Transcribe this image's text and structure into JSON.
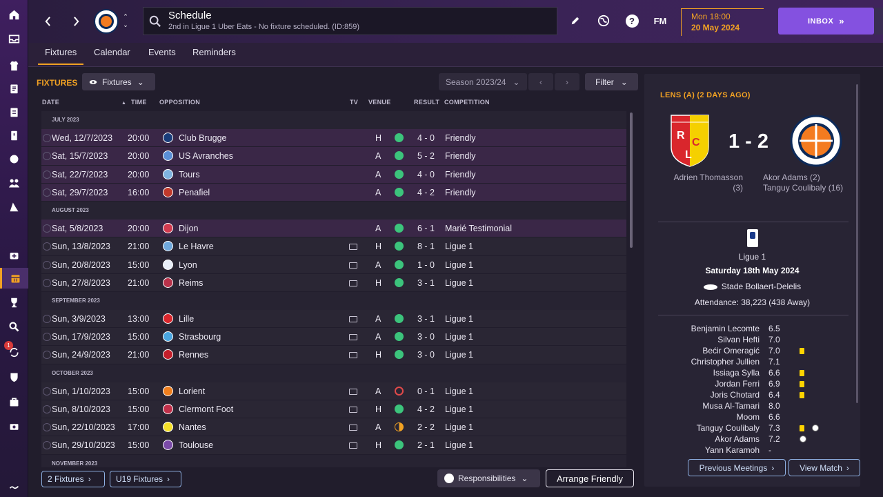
{
  "sidebar": {
    "badge_count": "1",
    "items": [
      "home-icon",
      "inbox-icon",
      "squad-icon",
      "tactics-icon",
      "data-icon",
      "staff-icon",
      "training-icon",
      "medical-icon",
      "schedule-icon",
      "competitions-icon",
      "scouting-icon",
      "transfers-icon",
      "club-vision-icon",
      "finances-icon",
      "dev-centre-icon",
      "report-icon",
      "settings-icon"
    ]
  },
  "header": {
    "title": "Schedule",
    "subtitle": "2nd in Ligue 1 Uber Eats - No fixture scheduled. (ID:859)",
    "fm_label": "FM",
    "date_line1": "Mon 18:00",
    "date_line2": "20 May 2024",
    "inbox_label": "INBOX"
  },
  "tabs": [
    "Fixtures",
    "Calendar",
    "Events",
    "Reminders"
  ],
  "fixtures": {
    "heading": "FIXTURES",
    "view_dropdown": "Fixtures",
    "season": "Season 2023/24",
    "filter": "Filter",
    "columns": {
      "date": "DATE",
      "time": "TIME",
      "opposition": "OPPOSITION",
      "tv": "TV",
      "venue": "VENUE",
      "result": "RESULT",
      "competition": "COMPETITION"
    },
    "groups": [
      {
        "month": "JULY 2023",
        "rows": [
          {
            "date": "Wed, 12/7/2023",
            "time": "20:00",
            "opp": "Club Brugge",
            "tv": false,
            "venue": "H",
            "outcome": "w",
            "result": "4 - 0",
            "comp": "Friendly",
            "hl": true,
            "color": "#1a3d7a"
          },
          {
            "date": "Sat, 15/7/2023",
            "time": "20:00",
            "opp": "US Avranches",
            "tv": false,
            "venue": "A",
            "outcome": "w",
            "result": "5 - 2",
            "comp": "Friendly",
            "hl": true,
            "color": "#5a8fd6"
          },
          {
            "date": "Sat, 22/7/2023",
            "time": "20:00",
            "opp": "Tours",
            "tv": false,
            "venue": "A",
            "outcome": "w",
            "result": "4 - 0",
            "comp": "Friendly",
            "hl": true,
            "color": "#7fb3e0"
          },
          {
            "date": "Sat, 29/7/2023",
            "time": "16:00",
            "opp": "Penafiel",
            "tv": false,
            "venue": "A",
            "outcome": "w",
            "result": "4 - 2",
            "comp": "Friendly",
            "hl": true,
            "color": "#c0392b"
          }
        ]
      },
      {
        "month": "AUGUST 2023",
        "rows": [
          {
            "date": "Sat, 5/8/2023",
            "time": "20:00",
            "opp": "Dijon",
            "tv": false,
            "venue": "A",
            "outcome": "w",
            "result": "6 - 1",
            "comp": "Marié Testimonial",
            "hl": true,
            "color": "#d23a4f"
          },
          {
            "date": "Sun, 13/8/2023",
            "time": "21:00",
            "opp": "Le Havre",
            "tv": true,
            "venue": "H",
            "outcome": "w",
            "result": "8 - 1",
            "comp": "Ligue 1",
            "hl": false,
            "color": "#6fa8dc"
          },
          {
            "date": "Sun, 20/8/2023",
            "time": "15:00",
            "opp": "Lyon",
            "tv": true,
            "venue": "A",
            "outcome": "w",
            "result": "1 - 0",
            "comp": "Ligue 1",
            "hl": false,
            "color": "#e8eef8"
          },
          {
            "date": "Sun, 27/8/2023",
            "time": "21:00",
            "opp": "Reims",
            "tv": true,
            "venue": "H",
            "outcome": "w",
            "result": "3 - 1",
            "comp": "Ligue 1",
            "hl": false,
            "color": "#b8324a"
          }
        ]
      },
      {
        "month": "SEPTEMBER 2023",
        "rows": [
          {
            "date": "Sun, 3/9/2023",
            "time": "13:00",
            "opp": "Lille",
            "tv": true,
            "venue": "A",
            "outcome": "w",
            "result": "3 - 1",
            "comp": "Ligue 1",
            "hl": false,
            "color": "#d9262c"
          },
          {
            "date": "Sun, 17/9/2023",
            "time": "15:00",
            "opp": "Strasbourg",
            "tv": true,
            "venue": "A",
            "outcome": "w",
            "result": "3 - 0",
            "comp": "Ligue 1",
            "hl": false,
            "color": "#4aa6e0"
          },
          {
            "date": "Sun, 24/9/2023",
            "time": "21:00",
            "opp": "Rennes",
            "tv": true,
            "venue": "H",
            "outcome": "w",
            "result": "3 - 0",
            "comp": "Ligue 1",
            "hl": false,
            "color": "#c41e2a"
          }
        ]
      },
      {
        "month": "OCTOBER 2023",
        "rows": [
          {
            "date": "Sun, 1/10/2023",
            "time": "15:00",
            "opp": "Lorient",
            "tv": true,
            "venue": "A",
            "outcome": "l",
            "result": "0 - 1",
            "comp": "Ligue 1",
            "hl": false,
            "color": "#f07f1e"
          },
          {
            "date": "Sun, 8/10/2023",
            "time": "15:00",
            "opp": "Clermont Foot",
            "tv": true,
            "venue": "H",
            "outcome": "w",
            "result": "4 - 2",
            "comp": "Ligue 1",
            "hl": false,
            "color": "#c0304a"
          },
          {
            "date": "Sun, 22/10/2023",
            "time": "17:00",
            "opp": "Nantes",
            "tv": true,
            "venue": "A",
            "outcome": "d",
            "result": "2 - 2",
            "comp": "Ligue 1",
            "hl": false,
            "color": "#f5e02a"
          },
          {
            "date": "Sun, 29/10/2023",
            "time": "15:00",
            "opp": "Toulouse",
            "tv": true,
            "venue": "H",
            "outcome": "w",
            "result": "2 - 1",
            "comp": "Ligue 1",
            "hl": false,
            "color": "#7b4ba8"
          }
        ]
      },
      {
        "month": "NOVEMBER 2023",
        "rows": []
      }
    ],
    "footer": {
      "fixtures_btn": "2 Fixtures",
      "u19_btn": "U19 Fixtures",
      "responsibilities": "Responsibilities",
      "arrange": "Arrange Friendly"
    }
  },
  "match": {
    "title": "LENS (A) (2 DAYS AGO)",
    "score": "1 - 2",
    "home_scorer": "Adrien Thomasson (3)",
    "away_scorers": [
      "Akor Adams (2)",
      "Tanguy Coulibaly (16)"
    ],
    "competition": "Ligue 1",
    "date": "Saturday 18th May 2024",
    "stadium": "Stade Bollaert-Delelis",
    "attendance": "Attendance: 38,223 (438 Away)",
    "ratings": [
      {
        "name": "Benjamin Lecomte",
        "rating": "6.5",
        "yellow": false,
        "goal": false
      },
      {
        "name": "Silvan Hefti",
        "rating": "7.0",
        "yellow": false,
        "goal": false
      },
      {
        "name": "Bećir Omeragić",
        "rating": "7.0",
        "yellow": true,
        "goal": false
      },
      {
        "name": "Christopher Jullien",
        "rating": "7.1",
        "yellow": false,
        "goal": false
      },
      {
        "name": "Issiaga Sylla",
        "rating": "6.6",
        "yellow": true,
        "goal": false
      },
      {
        "name": "Jordan Ferri",
        "rating": "6.9",
        "yellow": true,
        "goal": false
      },
      {
        "name": "Joris Chotard",
        "rating": "6.4",
        "yellow": true,
        "goal": false
      },
      {
        "name": "Musa Al-Tamari",
        "rating": "8.0",
        "yellow": false,
        "goal": false
      },
      {
        "name": "Moom",
        "rating": "6.6",
        "yellow": false,
        "goal": false
      },
      {
        "name": "Tanguy Coulibaly",
        "rating": "7.3",
        "yellow": true,
        "goal": true
      },
      {
        "name": "Akor Adams",
        "rating": "7.2",
        "yellow": false,
        "goal": true
      },
      {
        "name": "Yann Karamoh",
        "rating": "-",
        "yellow": false,
        "goal": false
      }
    ],
    "prev_btn": "Previous Meetings",
    "view_btn": "View Match"
  }
}
